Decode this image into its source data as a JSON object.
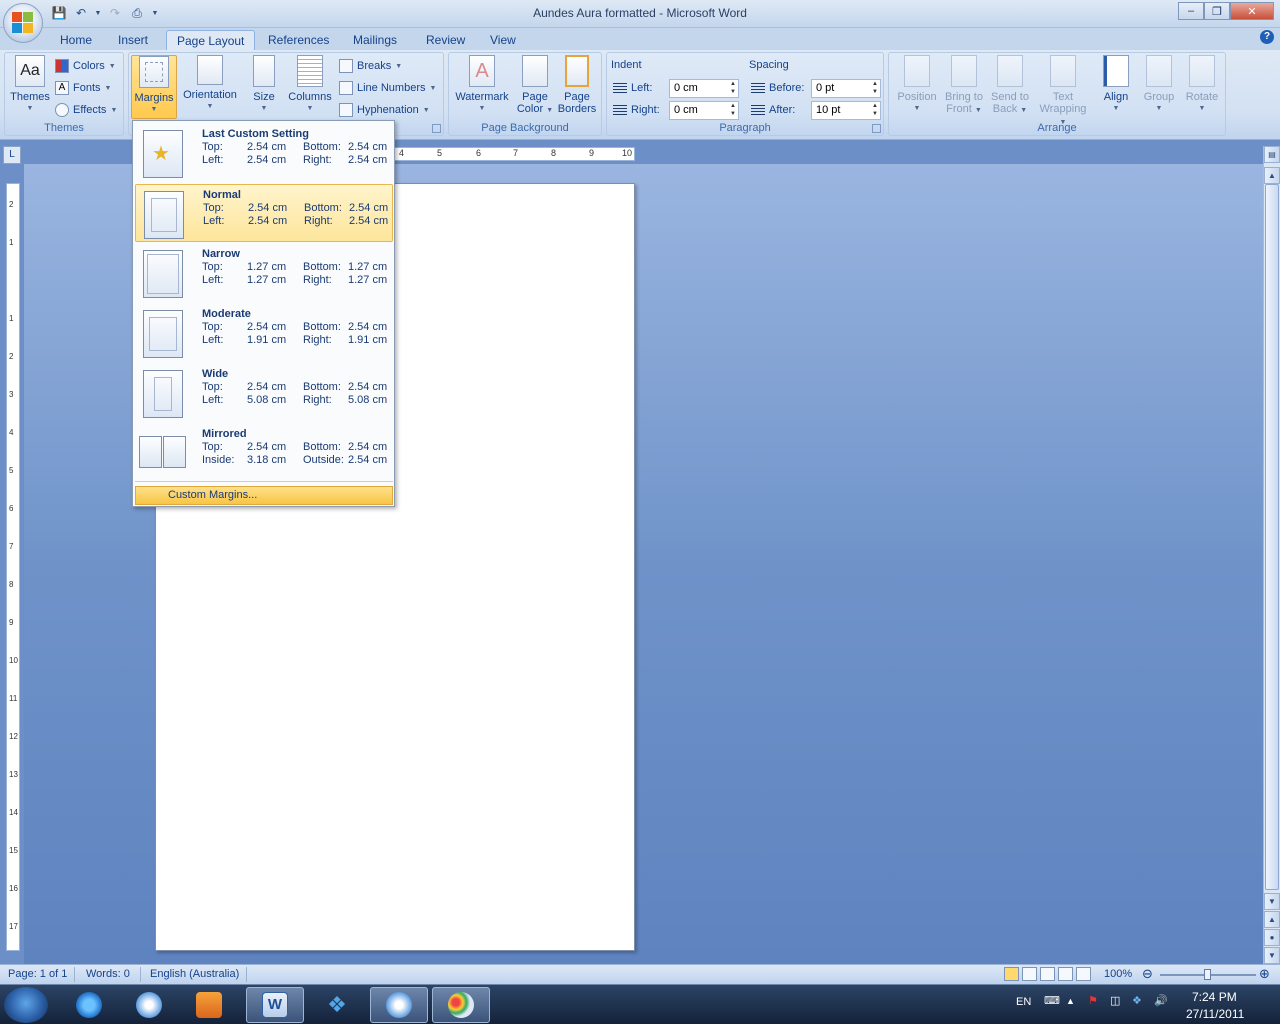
{
  "window": {
    "title": "Aundes Aura formatted - Microsoft Word"
  },
  "tabs": [
    "Home",
    "Insert",
    "Page Layout",
    "References",
    "Mailings",
    "Review",
    "View"
  ],
  "ribbon": {
    "themes": {
      "themes_label": "Themes",
      "colors": "Colors",
      "fonts": "Fonts",
      "effects": "Effects",
      "group": "Themes"
    },
    "page_setup": {
      "margins": "Margins",
      "orientation": "Orientation",
      "size": "Size",
      "columns": "Columns",
      "breaks": "Breaks",
      "line_numbers": "Line Numbers",
      "hyphenation": "Hyphenation"
    },
    "page_background": {
      "watermark": "Watermark",
      "page_color_1": "Page",
      "page_color_2": "Color",
      "page_borders_1": "Page",
      "page_borders_2": "Borders",
      "group": "Page Background"
    },
    "paragraph": {
      "indent_title": "Indent",
      "left_label": "Left:",
      "left_value": "0 cm",
      "right_label": "Right:",
      "right_value": "0 cm",
      "spacing_title": "Spacing",
      "before_label": "Before:",
      "before_value": "0 pt",
      "after_label": "After:",
      "after_value": "10 pt",
      "group": "Paragraph"
    },
    "arrange": {
      "position": "Position",
      "bring_1": "Bring to",
      "bring_2": "Front",
      "send_1": "Send to",
      "send_2": "Back",
      "text_1": "Text",
      "text_2": "Wrapping",
      "align": "Align",
      "group_btn": "Group",
      "rotate": "Rotate",
      "group": "Arrange"
    }
  },
  "margins_menu": {
    "options": [
      {
        "name": "Last Custom Setting",
        "r1l": "Top:",
        "r1v": "2.54 cm",
        "r1l2": "Bottom:",
        "r1v2": "2.54 cm",
        "r2l": "Left:",
        "r2v": "2.54 cm",
        "r2l2": "Right:",
        "r2v2": "2.54 cm"
      },
      {
        "name": "Normal",
        "r1l": "Top:",
        "r1v": "2.54 cm",
        "r1l2": "Bottom:",
        "r1v2": "2.54 cm",
        "r2l": "Left:",
        "r2v": "2.54 cm",
        "r2l2": "Right:",
        "r2v2": "2.54 cm"
      },
      {
        "name": "Narrow",
        "r1l": "Top:",
        "r1v": "1.27 cm",
        "r1l2": "Bottom:",
        "r1v2": "1.27 cm",
        "r2l": "Left:",
        "r2v": "1.27 cm",
        "r2l2": "Right:",
        "r2v2": "1.27 cm"
      },
      {
        "name": "Moderate",
        "r1l": "Top:",
        "r1v": "2.54 cm",
        "r1l2": "Bottom:",
        "r1v2": "2.54 cm",
        "r2l": "Left:",
        "r2v": "1.91 cm",
        "r2l2": "Right:",
        "r2v2": "1.91 cm"
      },
      {
        "name": "Wide",
        "r1l": "Top:",
        "r1v": "2.54 cm",
        "r1l2": "Bottom:",
        "r1v2": "2.54 cm",
        "r2l": "Left:",
        "r2v": "5.08 cm",
        "r2l2": "Right:",
        "r2v2": "5.08 cm"
      },
      {
        "name": "Mirrored",
        "r1l": "Top:",
        "r1v": "2.54 cm",
        "r1l2": "Bottom:",
        "r1v2": "2.54 cm",
        "r2l": "Inside:",
        "r2v": "3.18 cm",
        "r2l2": "Outside:",
        "r2v2": "2.54 cm"
      }
    ],
    "custom": "Custom Margins..."
  },
  "ruler": {
    "h_numbers": [
      "4",
      "5",
      "6",
      "7",
      "8",
      "9",
      "10"
    ],
    "v_numbers": [
      "2",
      "1",
      "1",
      "2",
      "3",
      "4",
      "5",
      "6",
      "7",
      "8",
      "9",
      "10",
      "11",
      "12",
      "13",
      "14",
      "15",
      "16",
      "17"
    ]
  },
  "status": {
    "page": "Page: 1 of 1",
    "words": "Words: 0",
    "language": "English (Australia)",
    "zoom": "100%"
  },
  "tray": {
    "lang": "EN",
    "time": "7:24 PM",
    "date": "27/11/2011"
  },
  "colors": {
    "accent": "#15428b",
    "selected": "#fde59b"
  }
}
